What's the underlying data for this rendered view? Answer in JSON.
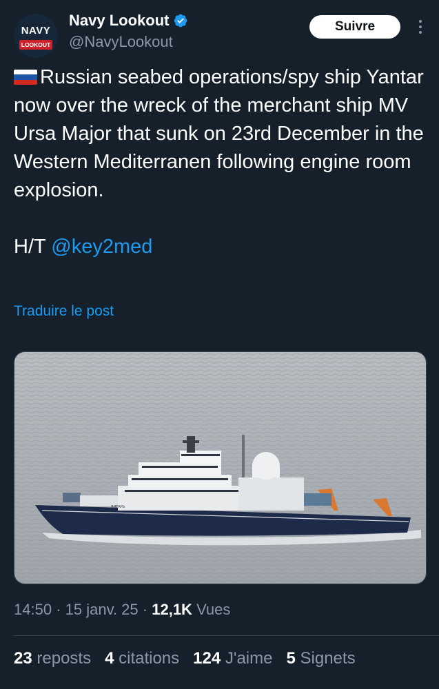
{
  "author": {
    "display_name": "Navy Lookout",
    "handle": "@NavyLookout",
    "avatar_text_top": "NAVY",
    "avatar_text_bottom": "LOOKOUT"
  },
  "follow_label": "Suivre",
  "tweet": {
    "text": "Russian seabed operations/spy ship Yantar now over the wreck of the merchant ship MV Ursa Major that sunk on 23rd December in the Western Mediterranen following engine room explosion.",
    "ht_prefix": "H/T ",
    "mention": "@key2med",
    "flag_icon": "russia-flag-icon"
  },
  "translate_label": "Traduire le post",
  "media": {
    "hull_text": "ЯНТАРЬ"
  },
  "meta": {
    "time": "14:50",
    "date": "15 janv. 25",
    "views_count": "12,1K",
    "views_label": "Vues"
  },
  "stats": [
    {
      "count": "23",
      "label": "reposts"
    },
    {
      "count": "4",
      "label": "citations"
    },
    {
      "count": "124",
      "label": "J'aime"
    },
    {
      "count": "5",
      "label": "Signets"
    }
  ],
  "colors": {
    "background": "#15202b",
    "link": "#1d9bf0",
    "secondary_text": "#8b98a5",
    "verified": "#1d9bf0"
  }
}
